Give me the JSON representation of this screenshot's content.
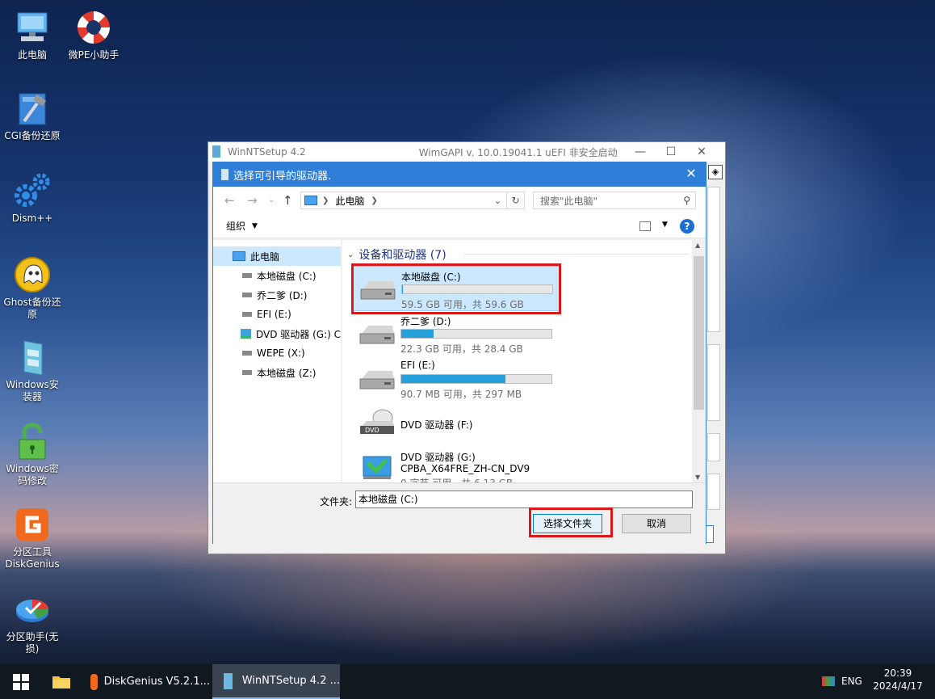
{
  "desktop": {
    "icons": [
      {
        "label": "此电脑"
      },
      {
        "label": "微PE小助手"
      },
      {
        "label": "CGI备份还原"
      },
      {
        "label": "Dism++"
      },
      {
        "label": "Ghost备份还原"
      },
      {
        "label": "Windows安装器"
      },
      {
        "label": "Windows密码修改"
      },
      {
        "label": "分区工具DiskGenius"
      },
      {
        "label": "分区助手(无损)"
      }
    ]
  },
  "background_window": {
    "title": "WinNTSetup 4.2",
    "subtitle": "WimGAPI v. 10.0.19041.1   uEFI 非安全启动"
  },
  "dialog": {
    "title": "选择可引导的驱动器.",
    "address": {
      "location": "此电脑"
    },
    "search_placeholder": "搜索\"此电脑\"",
    "organize_label": "组织",
    "tree": [
      {
        "label": "此电脑",
        "icon": "computer-icon"
      },
      {
        "label": "本地磁盘 (C:)",
        "icon": "drive-icon"
      },
      {
        "label": "乔二爹 (D:)",
        "icon": "drive-icon"
      },
      {
        "label": "EFI (E:)",
        "icon": "drive-icon"
      },
      {
        "label": "DVD 驱动器 (G:) C",
        "icon": "dvd-drive-icon"
      },
      {
        "label": "WEPE (X:)",
        "icon": "drive-icon"
      },
      {
        "label": "本地磁盘 (Z:)",
        "icon": "drive-icon"
      }
    ],
    "group_header": "设备和驱动器 (7)",
    "drives": [
      {
        "name": "本地磁盘 (C:)",
        "info": "59.5 GB 可用，共 59.6 GB",
        "used_fraction": 0.002
      },
      {
        "name": "乔二爹 (D:)",
        "info": "22.3 GB 可用，共 28.4 GB",
        "used_fraction": 0.215
      },
      {
        "name": "EFI (E:)",
        "info": "90.7 MB 可用，共 297 MB",
        "used_fraction": 0.695
      },
      {
        "name": "DVD 驱动器 (F:)",
        "info": ""
      },
      {
        "name": "DVD 驱动器 (G:)",
        "label2": "CPBA_X64FRE_ZH-CN_DV9",
        "info": "0 字节 可用，共 6.13 GB"
      }
    ],
    "folder_label": "文件夹:",
    "folder_value": "本地磁盘 (C:)",
    "select_button": "选择文件夹",
    "cancel_button": "取消",
    "dvd_badge": "DVD"
  },
  "taskbar": {
    "tasks": [
      {
        "label": "DiskGenius V5.2.1..."
      },
      {
        "label": "WinNTSetup 4.2  ..."
      }
    ],
    "language": "ENG",
    "time": "20:39",
    "date": "2024/4/17"
  },
  "colors": {
    "accent": "#2f7fd8",
    "selection": "#cce8ff",
    "bar_fill": "#26a0da",
    "highlight": "#d7191c"
  }
}
